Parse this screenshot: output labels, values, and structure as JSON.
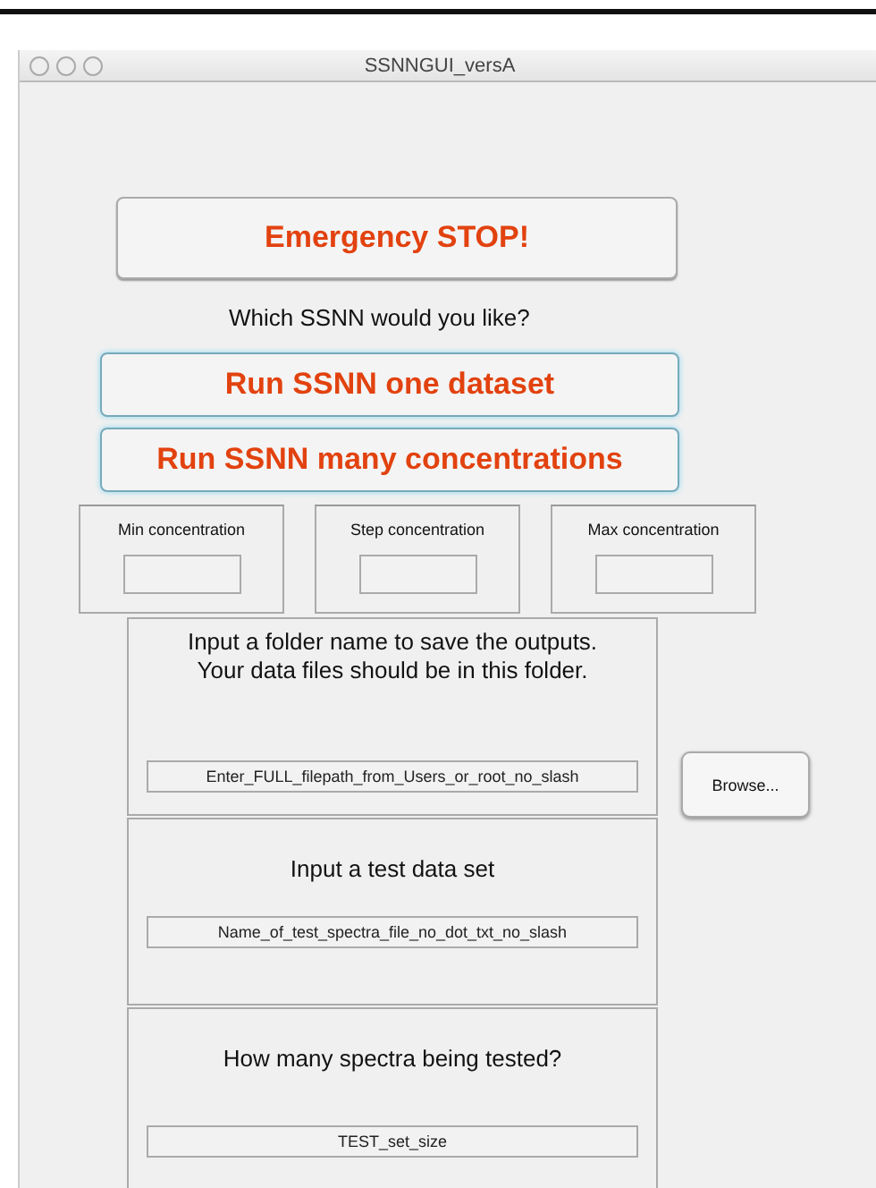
{
  "window": {
    "title": "SSNNGUI_versA"
  },
  "stop_button": "Emergency STOP!",
  "prompt": "Which SSNN would you like?",
  "run_buttons": [
    "Run SSNN one dataset",
    "Run SSNN many concentrations"
  ],
  "concentration_panels": [
    {
      "label": "Min concentration"
    },
    {
      "label": "Step concentration"
    },
    {
      "label": "Max concentration"
    }
  ],
  "folder_panel": {
    "label": "Input a folder name to save the outputs.\nYour data files should be in this folder.",
    "value": "Enter_FULL_filepath_from_Users_or_root_no_slash"
  },
  "browse_button": "Browse...",
  "test_panel": {
    "label": "Input a test data set",
    "value": "Name_of_test_spectra_file_no_dot_txt_no_slash"
  },
  "spectra_panel": {
    "label": "How many spectra being tested?",
    "value": "TEST_set_size"
  }
}
